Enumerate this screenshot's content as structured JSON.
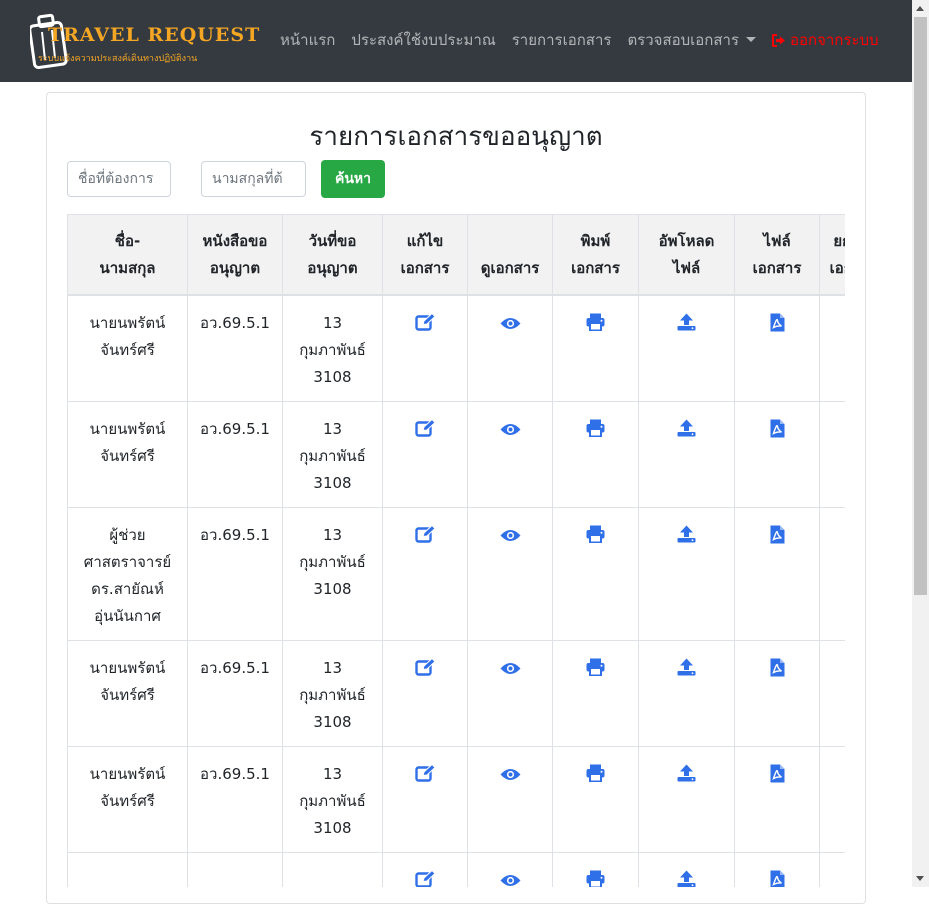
{
  "brand": {
    "title": "TRAVEL REQUEST",
    "subtitle": "ระบบแจ้งความประสงค์เดินทางปฏิบัติงาน"
  },
  "nav": {
    "home": "หน้าแรก",
    "budget": "ประสงค์ใช้งบประมาณ",
    "documents": "รายการเอกสาร",
    "verify": "ตรวจสอบเอกสาร",
    "logout": "ออกจากระบบ"
  },
  "page": {
    "title": "รายการเอกสารขออนุญาต"
  },
  "search": {
    "first_placeholder": "ชื่อที่ต้องการ",
    "last_placeholder": "นามสกุลที่ต้",
    "button": "ค้นหา"
  },
  "table": {
    "headers": [
      "ชื่อ-นามสกุล",
      "หนังสือขออนุญาต",
      "วันที่ขออนุญาต",
      "แก้ไขเอกสาร",
      "ดูเอกสาร",
      "พิมพ์เอกสาร",
      "อัพโหลดไฟล์",
      "ไฟล์เอกสาร",
      "ยกเลิกเอกสาร"
    ],
    "rows": [
      {
        "name": "นายนพรัตน์ จันทร์ศรี",
        "doc_no": "อว.69.5.1",
        "date": "13 กุมภาพันธ์ 3108"
      },
      {
        "name": "นายนพรัตน์ จันทร์ศรี",
        "doc_no": "อว.69.5.1",
        "date": "13 กุมภาพันธ์ 3108"
      },
      {
        "name": "ผู้ช่วยศาสตราจารย์ ดร.สายัณห์ อุ่นนันกาศ",
        "doc_no": "อว.69.5.1",
        "date": "13 กุมภาพันธ์ 3108"
      },
      {
        "name": "นายนพรัตน์ จันทร์ศรี",
        "doc_no": "อว.69.5.1",
        "date": "13 กุมภาพันธ์ 3108"
      },
      {
        "name": "นายนพรัตน์ จันทร์ศรี",
        "doc_no": "อว.69.5.1",
        "date": "13 กุมภาพันธ์ 3108"
      },
      {
        "name": "",
        "doc_no": "",
        "date": ""
      }
    ]
  },
  "colors": {
    "navbar": "#343a40",
    "brand": "#f5a623",
    "logout": "#ff0000",
    "icon": "#2f6fe8",
    "search_button": "#28a745"
  },
  "icons": [
    "edit-icon",
    "eye-icon",
    "print-icon",
    "upload-icon",
    "pdf-file-icon",
    "sign-out-icon"
  ]
}
